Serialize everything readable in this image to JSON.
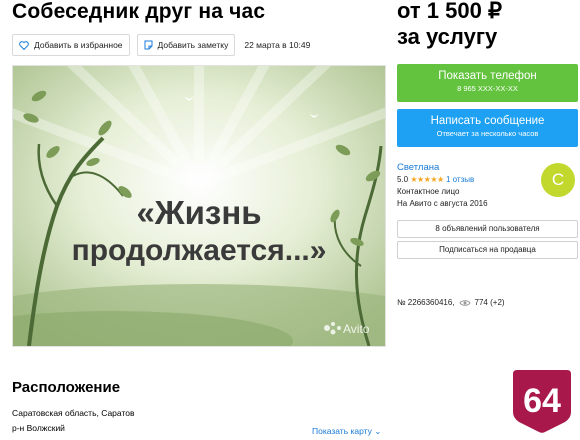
{
  "listing": {
    "title": "Собеседник друг на час",
    "price_line1": "от 1 500 ₽",
    "price_line2": "за услугу"
  },
  "actions": {
    "favorite_label": "Добавить в избранное",
    "note_label": "Добавить заметку",
    "date": "22 марта в 10:49"
  },
  "photo": {
    "caption_line1": "«Жизнь",
    "caption_line2": "продолжается...»",
    "watermark": "Avito"
  },
  "contact": {
    "phone_label": "Показать телефон",
    "phone_masked": "8 965 XXX-XX-XX",
    "message_label": "Написать сообщение",
    "message_sub": "Отвечает за несколько часов"
  },
  "seller": {
    "name": "Светлана",
    "rating": "5.0",
    "stars": "★★★★★",
    "reviews": "1 отзыв",
    "role": "Контактное лицо",
    "since": "На Авито с августа 2016",
    "avatar_letter": "С",
    "avatar_color": "#c3d82c",
    "listings_button": "8 объявлений пользователя",
    "subscribe_button": "Подписаться на продавца"
  },
  "ad_info": {
    "number": "№ 2266360416,",
    "views": "774 (+2)"
  },
  "location": {
    "title": "Расположение",
    "region": "Саратовская область, Саратов",
    "district": "р-н Волжский",
    "map_link": "Показать карту"
  },
  "badge": {
    "text": "64",
    "color": "#a8184a"
  },
  "colors": {
    "phone_button": "#63c33e",
    "message_button": "#1ea1f2",
    "link": "#1a7bd8",
    "star": "#f5a623"
  }
}
